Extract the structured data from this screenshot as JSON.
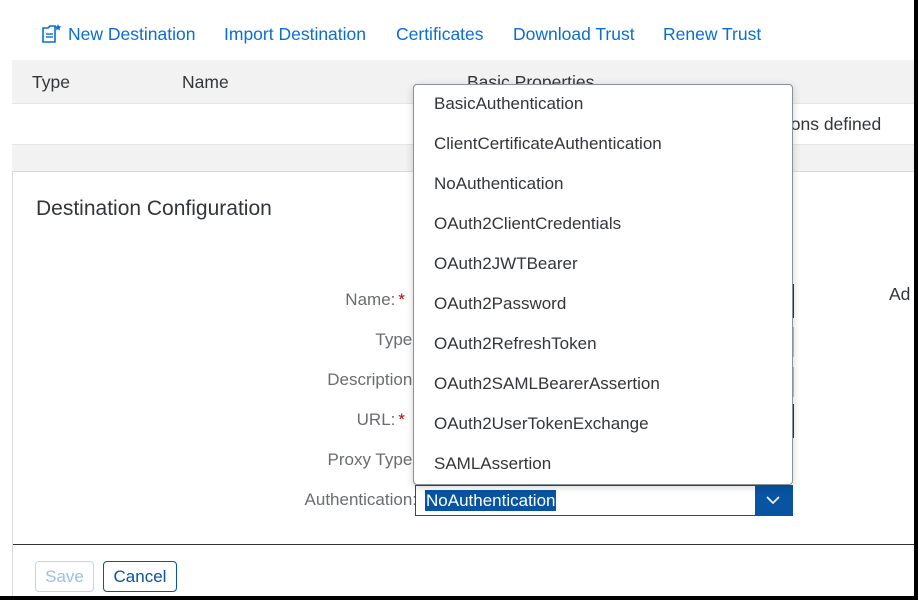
{
  "toolbar": {
    "new_destination": "New Destination",
    "import_destination": "Import Destination",
    "certificates": "Certificates",
    "download_trust": "Download Trust",
    "renew_trust": "Renew Trust"
  },
  "table": {
    "headers": {
      "type": "Type",
      "name": "Name",
      "basic_properties": "Basic Properties"
    },
    "row_text": "tions defined"
  },
  "panel": {
    "title": "Destination Configuration",
    "side_label": "Ad",
    "fields": {
      "name": "Name:",
      "type": "Type:",
      "description": "Description:",
      "url": "URL:",
      "proxy_type": "Proxy Type:",
      "authentication": "Authentication:"
    },
    "required_mark": "*",
    "authentication_value": "NoAuthentication"
  },
  "dropdown": {
    "options": [
      "BasicAuthentication",
      "ClientCertificateAuthentication",
      "NoAuthentication",
      "OAuth2ClientCredentials",
      "OAuth2JWTBearer",
      "OAuth2Password",
      "OAuth2RefreshToken",
      "OAuth2SAMLBearerAssertion",
      "OAuth2UserTokenExchange",
      "SAMLAssertion"
    ]
  },
  "footer": {
    "save": "Save",
    "cancel": "Cancel"
  },
  "colors": {
    "accent": "#0854a0",
    "link": "#0a6ed1",
    "required": "#bb0000"
  }
}
